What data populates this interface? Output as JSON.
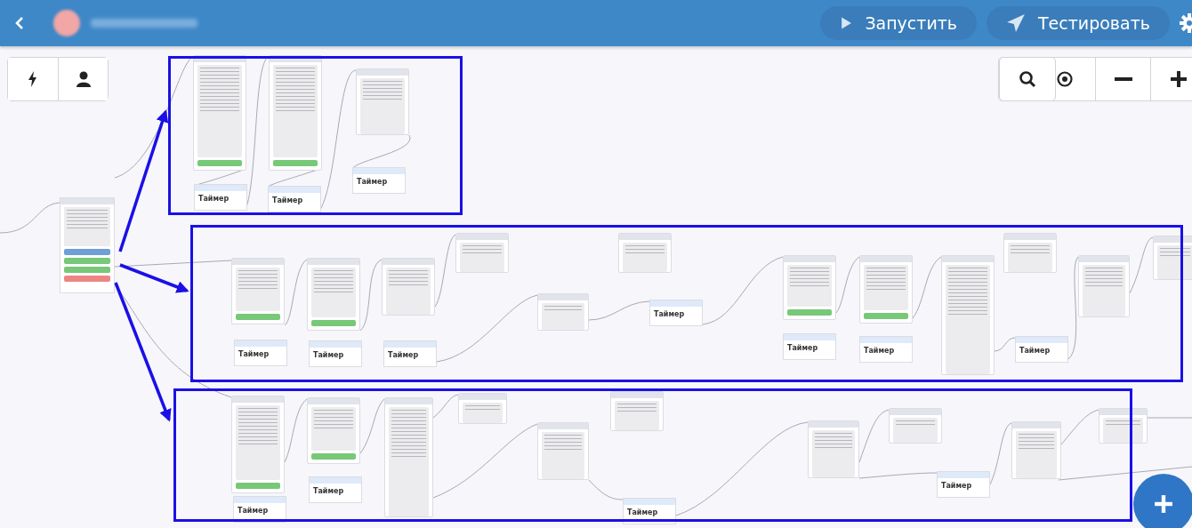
{
  "header": {
    "buttons": [
      {
        "kind": "run",
        "label": "Запустить"
      },
      {
        "kind": "test",
        "label": "Тестировать"
      }
    ]
  },
  "timers": [
    {
      "title": "Таймер"
    },
    {
      "title": "Таймер"
    },
    {
      "title": "Таймер"
    },
    {
      "title": "Таймер"
    },
    {
      "title": "Таймер"
    },
    {
      "title": "Таймер"
    },
    {
      "title": "Таймер"
    },
    {
      "title": "Таймер"
    },
    {
      "title": "Таймер"
    },
    {
      "title": "Таймер"
    },
    {
      "title": "Таймер"
    },
    {
      "title": "Таймер"
    },
    {
      "title": "Таймер"
    },
    {
      "title": "Таймер"
    }
  ]
}
